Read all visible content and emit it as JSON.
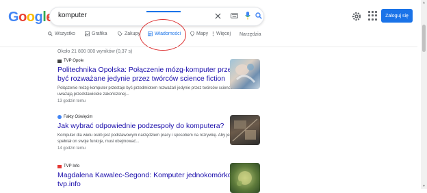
{
  "logo": {
    "text": "Google",
    "colors": [
      "#4285f4",
      "#ea4335",
      "#fbbc05",
      "#4285f4",
      "#34a853",
      "#ea4335"
    ]
  },
  "search": {
    "query": "komputer"
  },
  "header": {
    "login_label": "Zaloguj się"
  },
  "tabs": [
    {
      "label": "Wszystko",
      "icon": "search-icon"
    },
    {
      "label": "Grafika",
      "icon": "image-icon"
    },
    {
      "label": "Zakupy",
      "icon": "tag-icon"
    },
    {
      "label": "Wiadomości",
      "icon": "news-icon",
      "active": true
    },
    {
      "label": "Mapy",
      "icon": "map-icon"
    },
    {
      "label": "Więcej",
      "icon": "more-icon"
    }
  ],
  "tools_label": "Narzędzia",
  "stats": "Około 21 800 000 wyników (0,37 s)",
  "results": [
    {
      "source": "TVP Opole",
      "title": "Politechnika Opolska: Połączenie mózg-komputer przestaje być rozważane jedynie przez twórców science fiction",
      "snippet": "Połączenie mózg-komputer przestaje być przedmiotem rozważań jedynie przez twórców science fiction – uważają przedstawiciele zakończonej...",
      "time": "13 godzin temu"
    },
    {
      "source": "Fakty Oświęcim",
      "title": "Jak wybrać odpowiednie podzespoły do komputera?",
      "snippet": "Komputer dla wielu osób jest podstawowym narzędziem pracy i sposobem na rozrywkę. Aby jednak spełniał on swoje funkcje, musi obejmować...",
      "time": "14 godzin temu"
    },
    {
      "source": "TVP Info",
      "title": "Magdalena Kawalec-Segond: Komputer jednokomórkowca - tvp.info",
      "snippet": "",
      "time": ""
    }
  ],
  "accent_colors": {
    "link": "#1a0dab",
    "active_tab": "#1a73e8",
    "annotation": "#dd3333"
  }
}
